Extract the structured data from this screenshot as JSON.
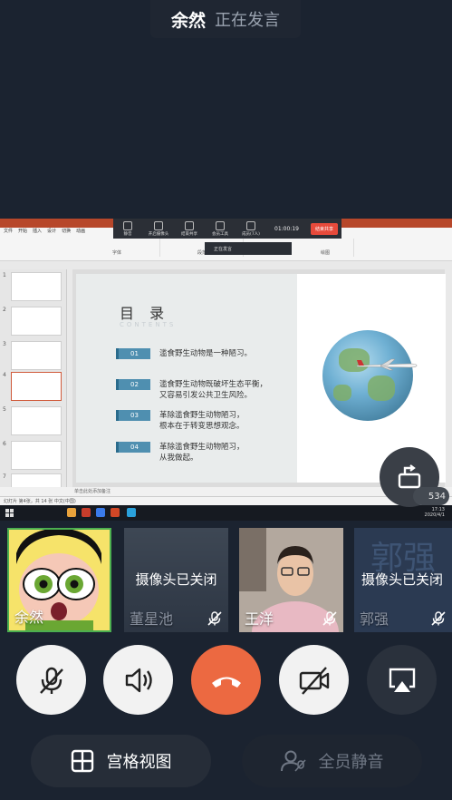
{
  "header": {
    "speaker": "余然",
    "status": "正在发言"
  },
  "shared_screen": {
    "ppt": {
      "ribbon_tabs": [
        "文件",
        "开始",
        "插入",
        "设计",
        "切换",
        "动画"
      ],
      "ribbon_groups": [
        "字体",
        "段落",
        "绘图"
      ],
      "meeting_toolbar": {
        "items": [
          "静音",
          "开启摄像头",
          "结束共享",
          "会员工具",
          "成员(7人)"
        ],
        "timer": "01:00:19",
        "end_label": "结束共享",
        "speaking": "正在发言"
      },
      "thumbnail_numbers": [
        "1",
        "2",
        "3",
        "4",
        "5",
        "6",
        "7"
      ],
      "slide": {
        "title": "目 录",
        "subtitle": "CONTENTS",
        "items": [
          {
            "num": "01",
            "text": "滥食野生动物是一种陋习。"
          },
          {
            "num": "02",
            "text": "滥食野生动物既破坏生态平衡，\n又容易引发公共卫生风险。"
          },
          {
            "num": "03",
            "text": "革除滥食野生动物陋习，\n根本在于转变思想观念。"
          },
          {
            "num": "04",
            "text": "革除滥食野生动物陋习，\n从我做起。"
          }
        ]
      },
      "notes": "单击此处添加备注",
      "status": "幻灯片 第4张，共 14 张     中文(中国)",
      "clock": {
        "time": "17:13",
        "date": "2020/4/1"
      }
    },
    "participant_count": "534"
  },
  "participants": [
    {
      "name": "余然",
      "camera_off": "",
      "active": true
    },
    {
      "name": "董星池",
      "camera_off": "摄像头已关闭",
      "active": false
    },
    {
      "name": "王洋",
      "camera_off": "",
      "active": false
    },
    {
      "name": "郭强",
      "camera_off": "摄像头已关闭",
      "watermark": "郭强",
      "active": false
    }
  ],
  "controls": {
    "grid_view": "宫格视图",
    "mute_all": "全员静音"
  },
  "icons": [
    "mic-off-icon",
    "speaker-icon",
    "hang-up-icon",
    "camera-off-icon",
    "airplay-icon",
    "grid-icon",
    "mute-all-icon",
    "rotate-screen-icon"
  ]
}
